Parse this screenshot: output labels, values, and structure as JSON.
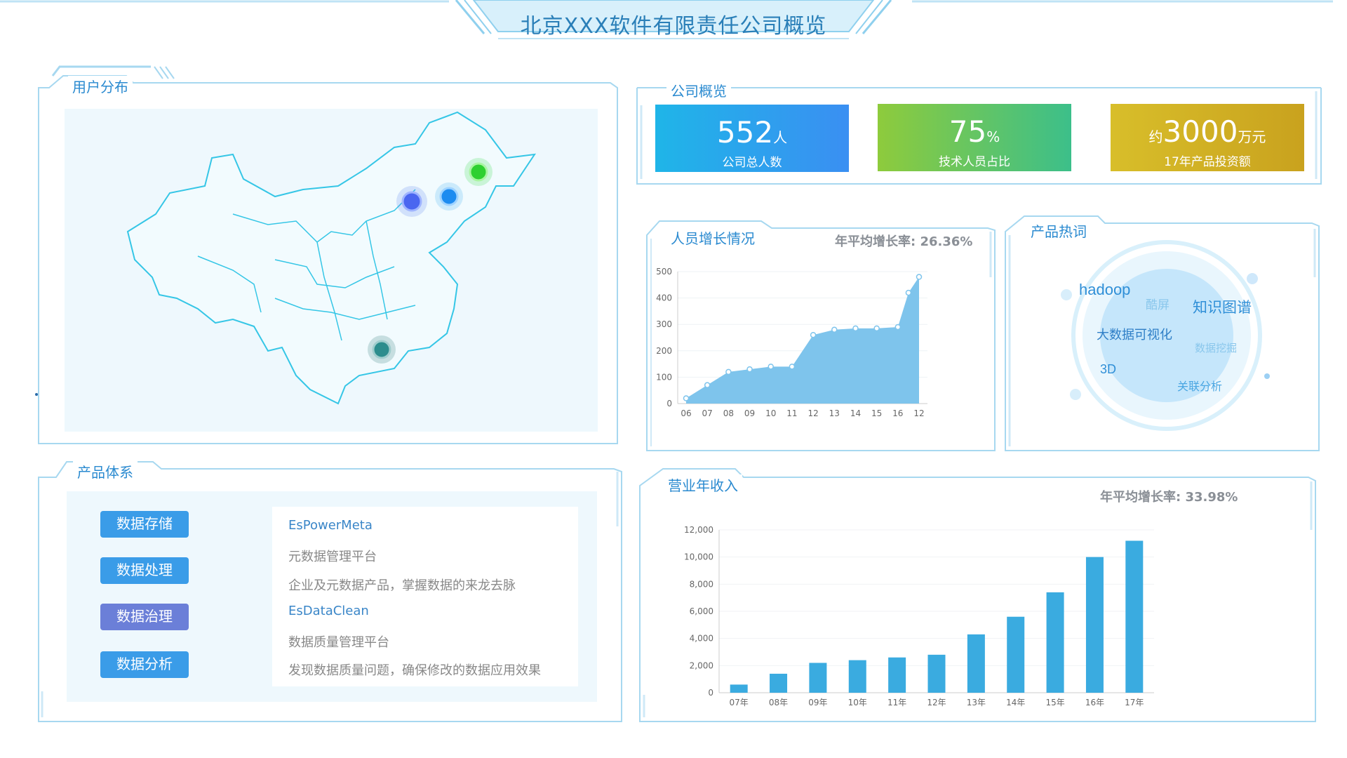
{
  "header": {
    "title": "北京XXX软件有限责任公司概览"
  },
  "user_distribution": {
    "title": "用户分布"
  },
  "company_overview": {
    "title": "公司概览",
    "cards": [
      {
        "value": "552",
        "unit": "人",
        "prefix": "",
        "label": "公司总人数",
        "color": "#2aa8ee"
      },
      {
        "value": "75",
        "unit": "%",
        "prefix": "",
        "label": "技术人员占比",
        "color": "#6cc45e"
      },
      {
        "value": "3000",
        "unit": "万元",
        "prefix": "约",
        "label": "17年产品投资额",
        "color": "#d2b626"
      }
    ]
  },
  "staff_growth": {
    "title": "人员增长情况",
    "stat_label": "年平均增长率:",
    "stat_value": "26.36%"
  },
  "hot_words": {
    "title": "产品热词",
    "words": [
      "hadoop",
      "酷屏",
      "知识图谱",
      "大数据可视化",
      "数据挖掘",
      "3D",
      "关联分析"
    ]
  },
  "product_system": {
    "title": "产品体系",
    "buttons": [
      "数据存储",
      "数据处理",
      "数据治理",
      "数据分析"
    ],
    "active_button": "数据治理",
    "lines": [
      "EsPowerMeta",
      "元数据管理平台",
      "企业及元数据产品，掌握数据的来龙去脉",
      "EsDataClean",
      "数据质量管理平台",
      "发现数据质量问题，确保修改的数据应用效果"
    ]
  },
  "revenue": {
    "title": "营业年收入",
    "stat_label": "年平均增长率:",
    "stat_value": "33.98%"
  },
  "chart_data": [
    {
      "type": "area",
      "categories": [
        "06",
        "07",
        "08",
        "09",
        "10",
        "11",
        "12",
        "13",
        "14",
        "15",
        "16",
        "12"
      ],
      "x_points": [
        0,
        0.5,
        1,
        1.5,
        2,
        2.5,
        3,
        3.5,
        4,
        4.5,
        5,
        5.5,
        6,
        6.5,
        7,
        7.5,
        8,
        8.5,
        9,
        9.5,
        10,
        10.5,
        11
      ],
      "values": [
        20,
        70,
        120,
        130,
        140,
        140,
        260,
        280,
        285,
        285,
        290,
        420,
        480
      ],
      "x_index": [
        0,
        1,
        2,
        3,
        4,
        5,
        6,
        7,
        8,
        9,
        10,
        10.5,
        11
      ],
      "yticks": [
        0,
        100,
        200,
        300,
        400,
        500
      ],
      "ylim": [
        0,
        500
      ],
      "color": "#7ec4ec"
    },
    {
      "type": "bar",
      "categories": [
        "07年",
        "08年",
        "09年",
        "10年",
        "11年",
        "12年",
        "13年",
        "14年",
        "15年",
        "16年",
        "17年"
      ],
      "values": [
        600,
        1400,
        2200,
        2400,
        2600,
        2800,
        4300,
        5600,
        7400,
        10000,
        11200
      ],
      "yticks": [
        "0",
        "2,000",
        "4,000",
        "6,000",
        "8,000",
        "10,000",
        "12,000"
      ],
      "ylim": [
        0,
        12000
      ],
      "color": "#3aabe0"
    }
  ]
}
